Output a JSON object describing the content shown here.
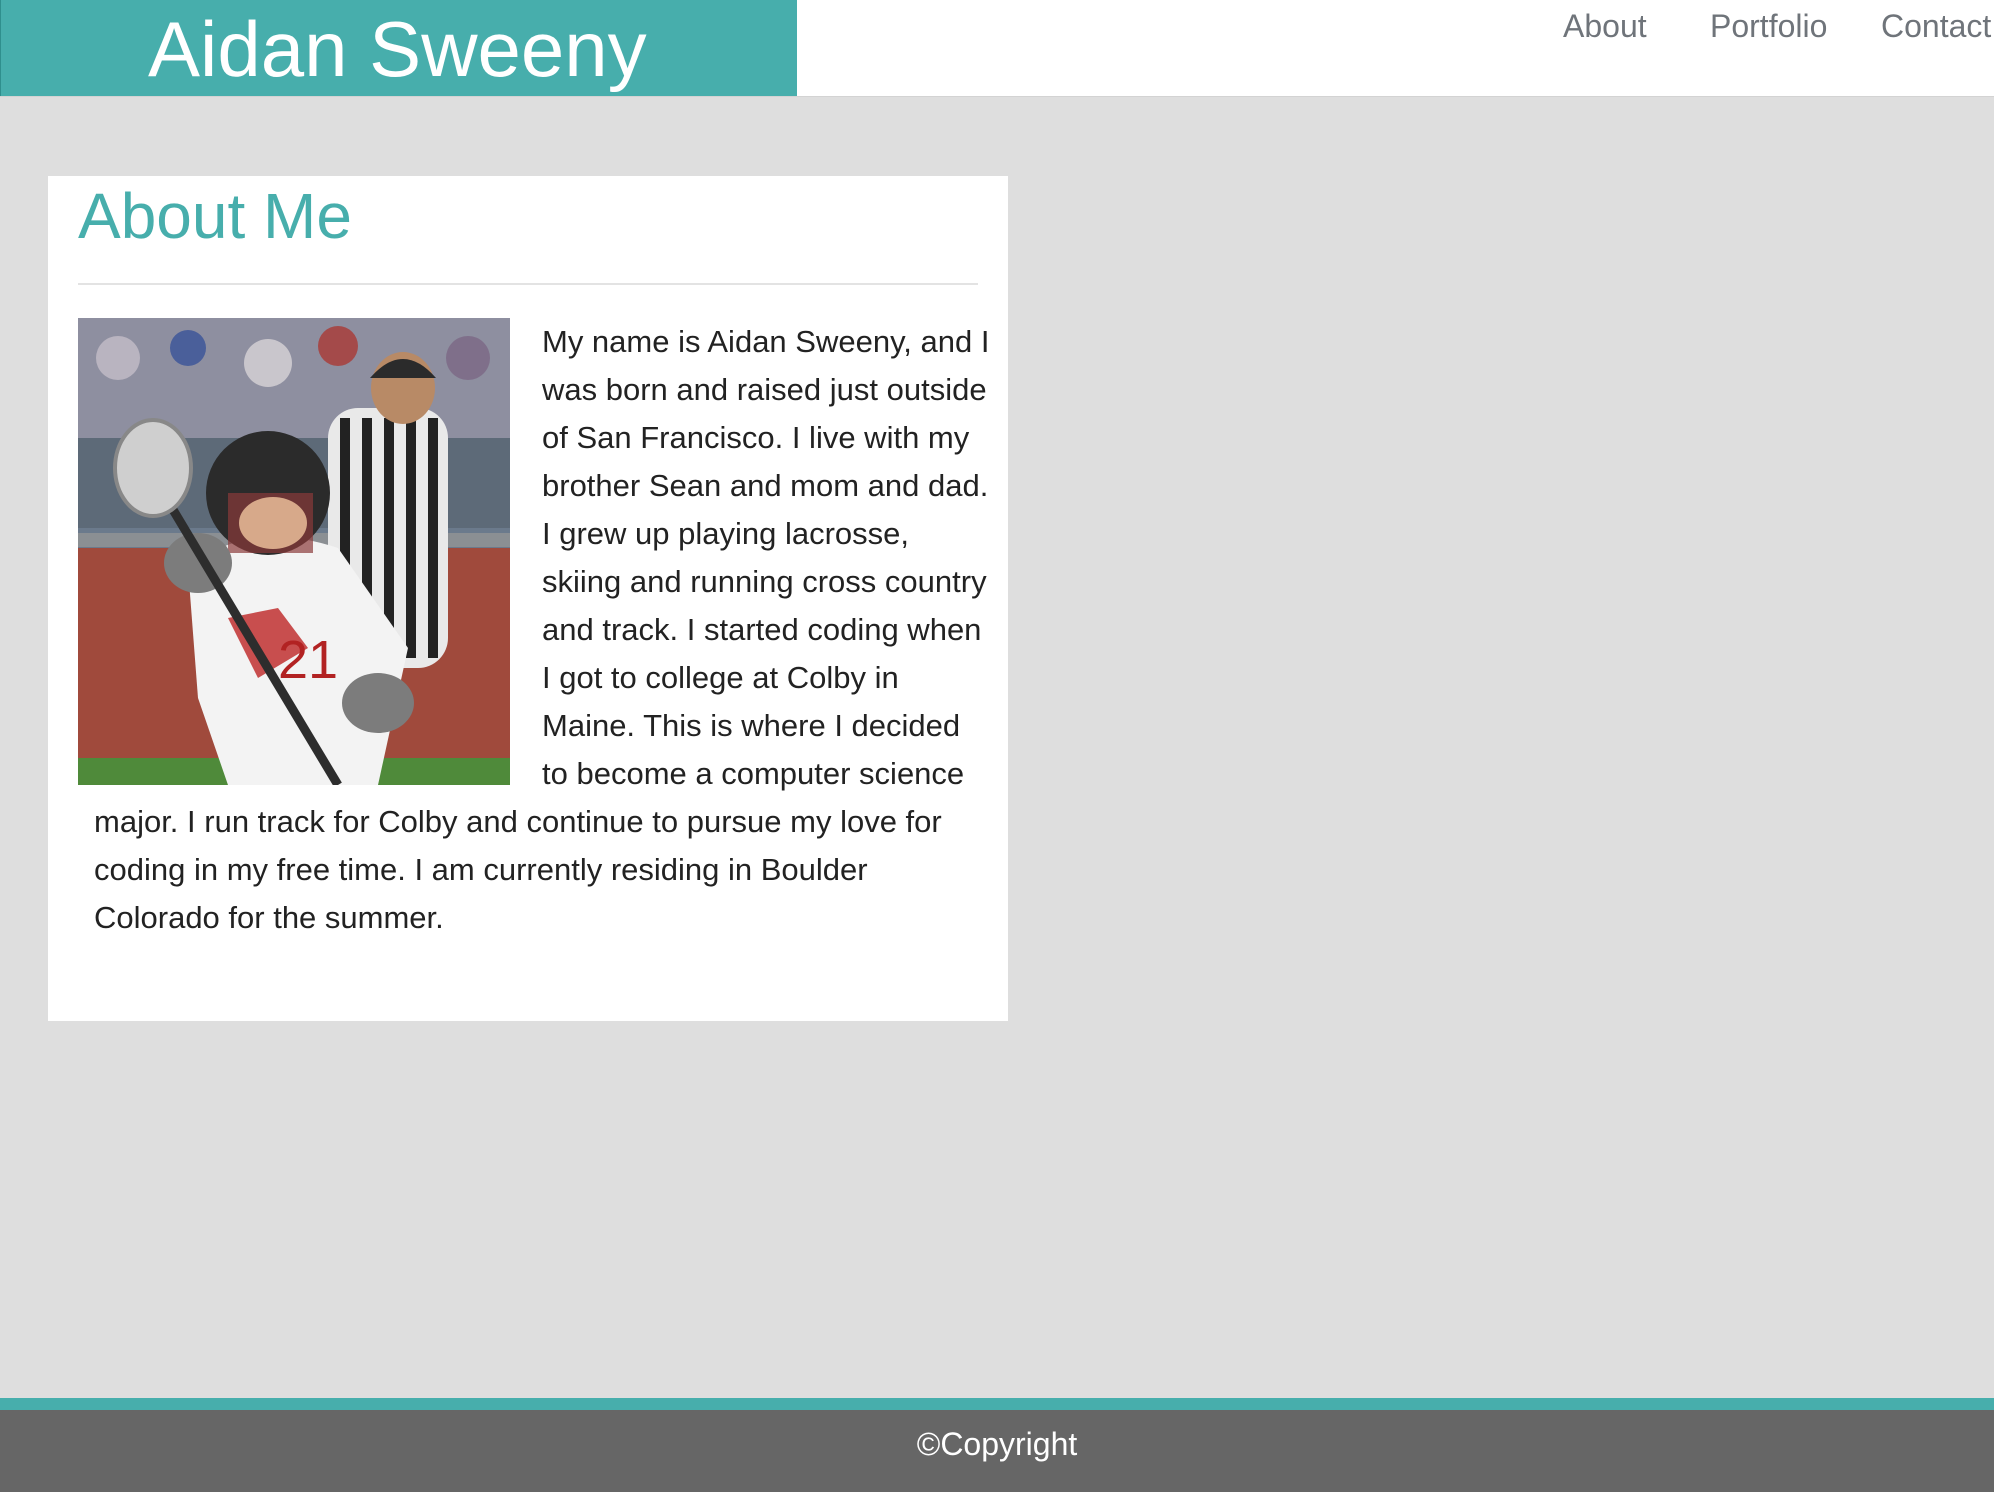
{
  "header": {
    "brand_name": "Aidan Sweeny",
    "nav": {
      "about": "About",
      "portfolio": "Portfolio",
      "contact": "Contact"
    }
  },
  "about": {
    "title": "About Me",
    "photo_icon": "lacrosse-player-photo",
    "bio": "My name is Aidan Sweeny, and I was born and raised just outside of San Francisco. I live with my brother Sean and mom and dad. I grew up playing lacrosse, skiing and running cross country and track. I started coding when I got to college at Colby in Maine. This is where I decided to become a computer science major. I run track for Colby and continue to pursue my love for coding in my free time. I am currently residing in Boulder Colorado for the summer."
  },
  "footer": {
    "copyright": "©Copyright"
  },
  "colors": {
    "accent": "#47aeac",
    "page_background": "#dedede",
    "footer_background": "#666666",
    "nav_text": "#6f747a"
  }
}
